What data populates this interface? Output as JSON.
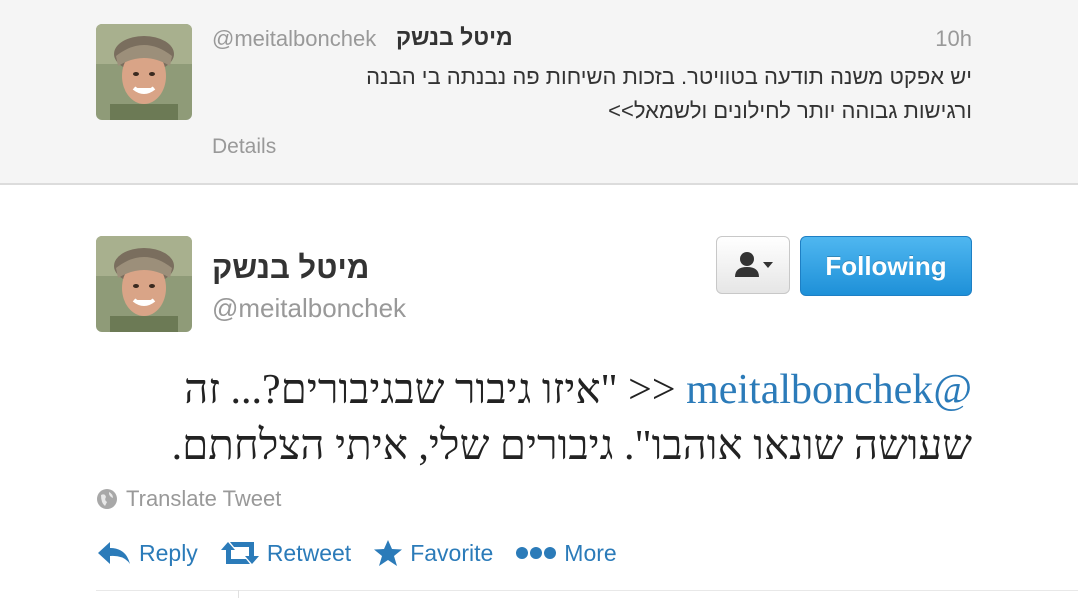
{
  "context_tweet": {
    "display_name": "מיטל בנשק",
    "handle": "@meitalbonchek",
    "time": "10h",
    "text_line1": "יש אפקט משנה תודעה בטוויטר. בזכות השיחות פה נבנתה בי הבנה",
    "text_line2": "ורגישות גבוהה יותר לחילונים ולשמאל>>",
    "details_label": "Details"
  },
  "main_tweet": {
    "display_name": "מיטל בנשק",
    "handle": "@meitalbonchek",
    "follow_label": "Following",
    "follow_color": "#1e90d8",
    "user_menu_icon": "person-dropdown-icon",
    "text_mention": "@meitalbonchek",
    "text_line1_rest": "<< \"איזו גיבור שבגיבורים?... זה",
    "text_line2": "שעושה שונאו אוהבו\". גיבורים שלי, איתי הצלחתם.",
    "translate_label": "Translate Tweet",
    "link_color": "#2b7bb9"
  },
  "actions": [
    {
      "icon": "reply-icon",
      "label": "Reply"
    },
    {
      "icon": "retweet-icon",
      "label": "Retweet"
    },
    {
      "icon": "star-icon",
      "label": "Favorite"
    },
    {
      "icon": "more-dots-icon",
      "label": "More"
    }
  ]
}
